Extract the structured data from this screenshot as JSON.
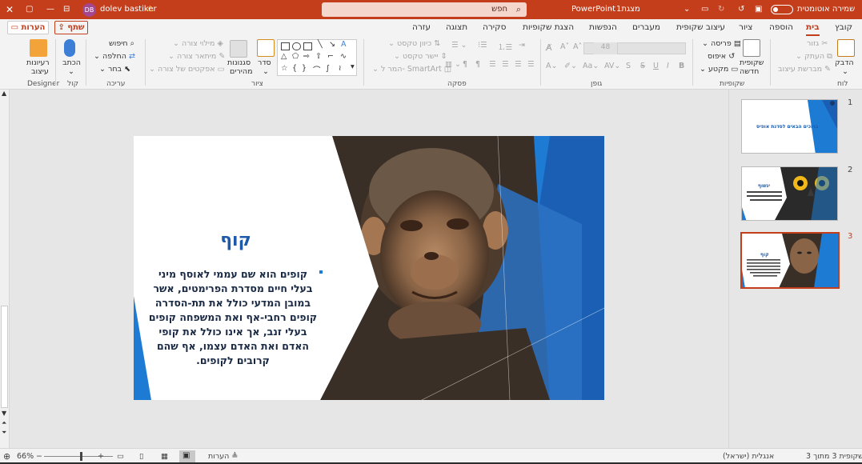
{
  "titlebar": {
    "autosave_label": "שמירה אוטומטית",
    "doc_name": "מצגת1",
    "app_name": "PowerPoint",
    "search_placeholder": "חפש",
    "user_name": "dolev bastiker",
    "user_initials": "DB",
    "warning_icon": "warning-icon"
  },
  "tabs": {
    "items": [
      "קובץ",
      "בית",
      "הוספה",
      "ציור",
      "עיצוב שקופית",
      "מעברים",
      "הנפשות",
      "הצגת שקופיות",
      "סקירה",
      "תצוגה",
      "עזרה"
    ],
    "active": "בית",
    "share_label": "שתף",
    "comments_label": "הערות"
  },
  "ribbon": {
    "clipboard": {
      "label": "לוח",
      "paste": "הדבק",
      "cut": "גזור",
      "copy": "העתק",
      "format_painter": "מברשת עיצוב"
    },
    "slides": {
      "label": "שקופיות",
      "new_slide_1": "שקופית",
      "new_slide_2": "חדשה",
      "layout": "פריסה",
      "reset": "איפוס",
      "section": "מקטע"
    },
    "font": {
      "label": "גופן",
      "size": "48",
      "bold": "B",
      "italic": "I",
      "underline": "U",
      "strike": "S"
    },
    "paragraph": {
      "label": "פסקה",
      "text_direction": "כיוון טקסט",
      "align_text": "יישר טקסט",
      "smartart": "המר ל- SmartArt"
    },
    "drawing": {
      "label": "ציור",
      "arrange": "סדר",
      "quick_styles_1": "סגנונות",
      "quick_styles_2": "מהירים",
      "shape_fill": "מילוי צורה",
      "shape_outline": "מיתאר צורה",
      "shape_effects": "אפקטים של צורה"
    },
    "editing": {
      "label": "עריכה",
      "find": "חיפוש",
      "replace": "החלפה",
      "select": "בחר"
    },
    "voice": {
      "label": "קול",
      "dictate": "הכתב"
    },
    "designer": {
      "label": "Designer",
      "ideas_1": "רעיונות",
      "ideas_2": "עיצוב"
    }
  },
  "slide": {
    "title": "קוף",
    "body": "קופים הוא שם עממי לאוסף מיני בעלי חיים מסדרת הפרימטים, אשר במובן המדעי כולל את תת-הסדרה קופים רחבי-אף ואת המשפחה קופים בעלי זנב, אך אינו כולל את קופי האדם ואת האדם עצמו, אף שהם קרובים לקופים.",
    "accent_color": "#1e7bd4",
    "dark_accent": "#1a5fb4"
  },
  "thumbnails": [
    {
      "number": "1",
      "text": "ברוכים הבאים לסדנת אופיס",
      "selected": false
    },
    {
      "number": "2",
      "text": "ינשוף",
      "selected": false
    },
    {
      "number": "3",
      "text": "קוף",
      "selected": true
    }
  ],
  "statusbar": {
    "slide_info": "שקופית 3 מתוך 3",
    "language": "אנגלית (ישראל)",
    "notes": "הערות",
    "zoom": "66%"
  },
  "colors": {
    "brand": "#c43e1c",
    "ribbon_bg": "#f3f3f3",
    "canvas_bg": "#e6e6e6"
  }
}
